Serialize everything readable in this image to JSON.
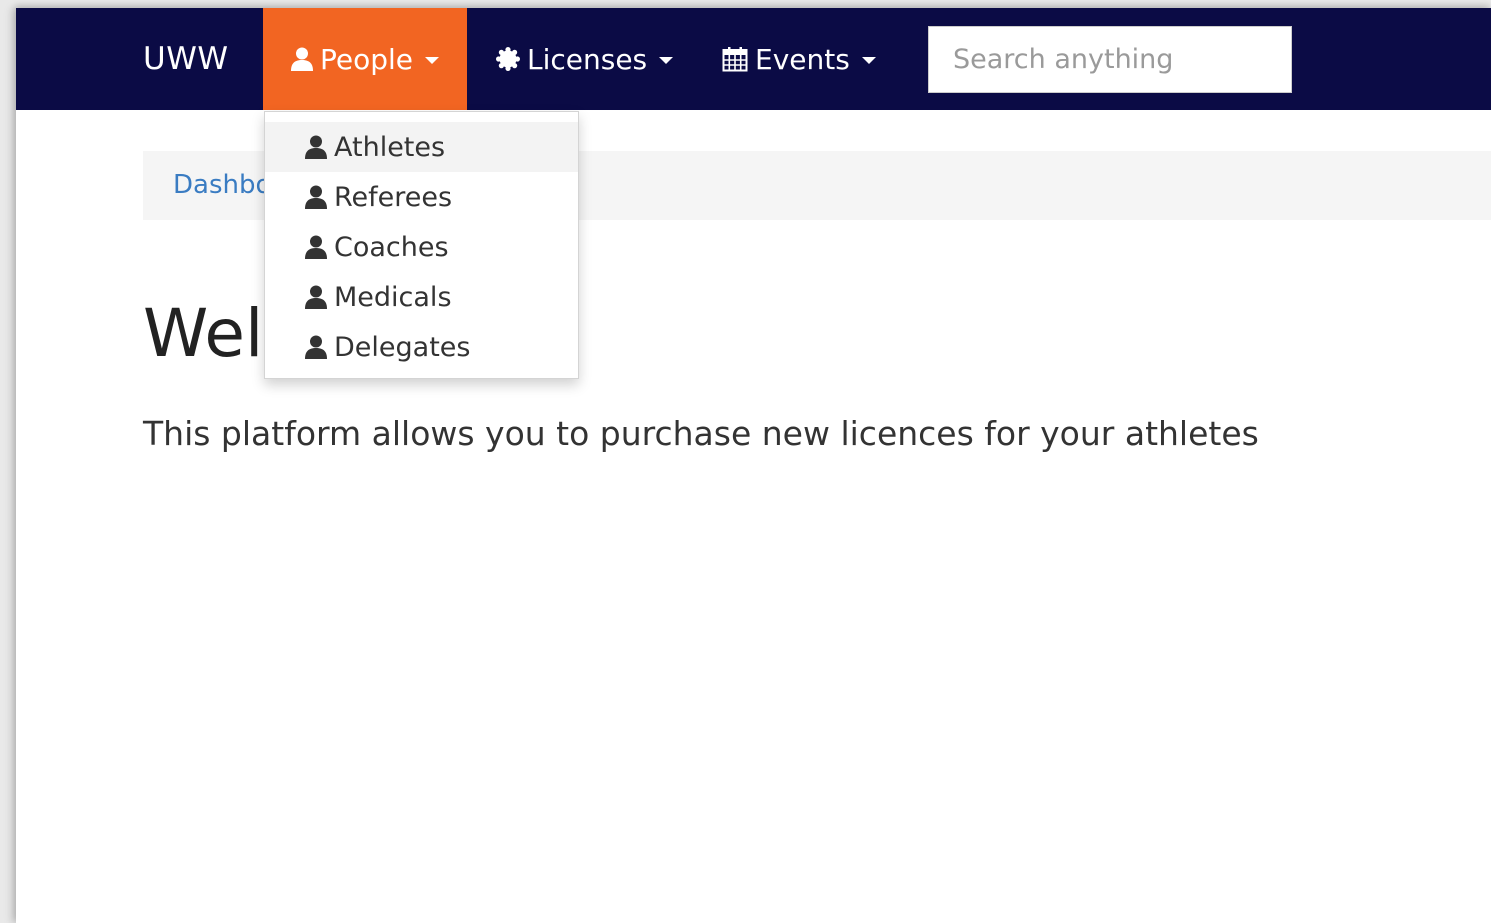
{
  "navbar": {
    "brand": "UWW",
    "people_label": "People",
    "licenses_label": "Licenses",
    "events_label": "Events",
    "search_placeholder": "Search anything",
    "background_color": "#0b0b45",
    "active_color": "#f26522"
  },
  "people_menu": {
    "items": [
      {
        "label": "Athletes",
        "icon": "user-icon"
      },
      {
        "label": "Referees",
        "icon": "user-icon"
      },
      {
        "label": "Coaches",
        "icon": "user-icon"
      },
      {
        "label": "Medicals",
        "icon": "user-icon"
      },
      {
        "label": "Delegates",
        "icon": "user-icon"
      }
    ]
  },
  "breadcrumb": {
    "visible_text": "Dashbo"
  },
  "main": {
    "title_visible": "Wel",
    "lead": "This platform allows you to purchase new licences for your athletes",
    "link_color": "#3a7cc2"
  }
}
